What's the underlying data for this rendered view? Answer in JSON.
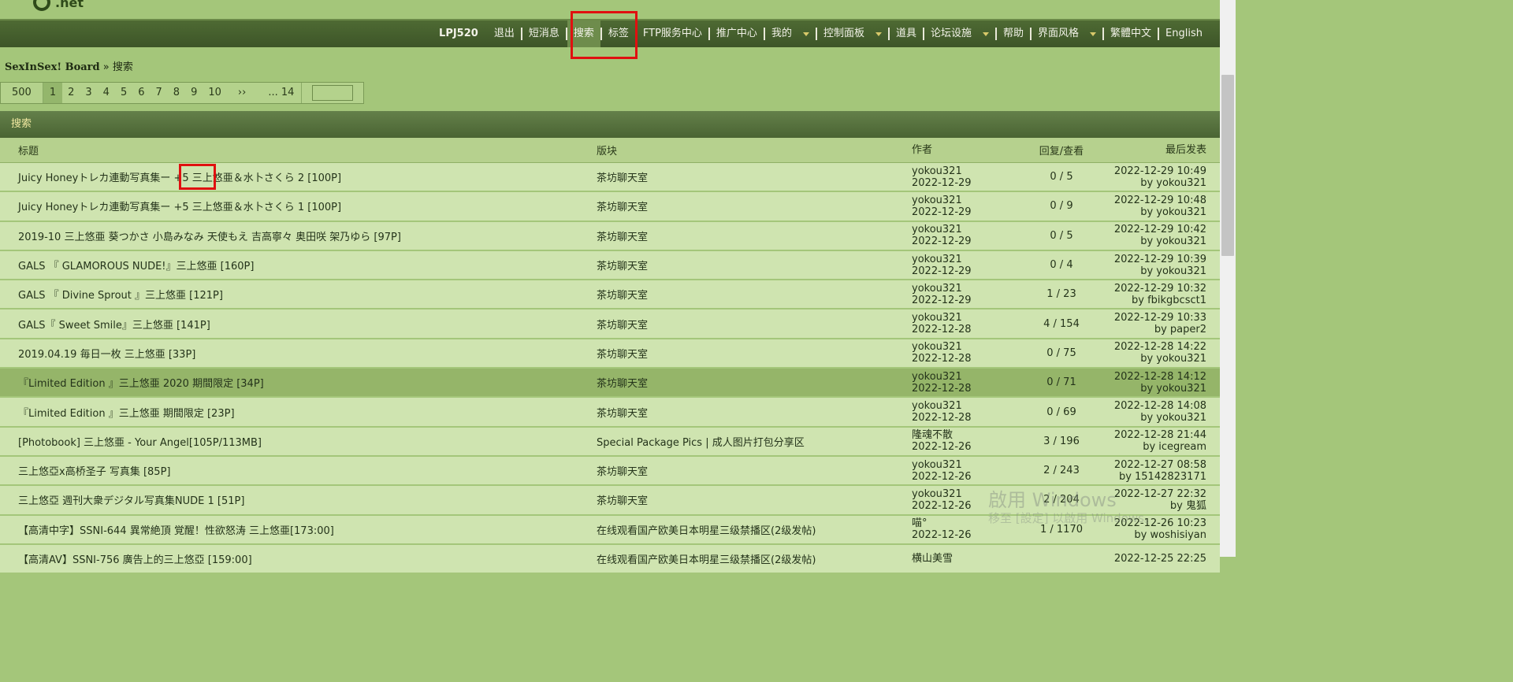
{
  "site": {
    "logo_text": ".net"
  },
  "nav": {
    "user": "LPJ520",
    "items": [
      {
        "label": "退出"
      },
      {
        "label": "短消息"
      },
      {
        "label": "搜索"
      },
      {
        "label": "标签"
      },
      {
        "label": "FTP服务中心"
      },
      {
        "label": "推广中心"
      },
      {
        "label": "我的"
      },
      {
        "label": "控制面板"
      },
      {
        "label": "道具"
      },
      {
        "label": "论坛设施"
      },
      {
        "label": "帮助"
      },
      {
        "label": "界面风格"
      },
      {
        "label": "繁體中文"
      },
      {
        "label": "English"
      }
    ]
  },
  "breadcrumb": {
    "board": "SexInSex! Board",
    "sep": " » ",
    "current": "搜索"
  },
  "pager": {
    "total": "500",
    "current": "1",
    "pages": [
      "2",
      "3",
      "4",
      "5",
      "6",
      "7",
      "8",
      "9",
      "10"
    ],
    "next": "››",
    "last": "... 14"
  },
  "section": {
    "title": "搜索"
  },
  "table": {
    "headers": {
      "title": "标题",
      "forum": "版块",
      "author": "作者",
      "replies": "回复/查看",
      "last": "最后发表"
    },
    "rows": [
      {
        "title": "Juicy Honeyトレカ連動写真集ー +5 三上悠亜＆水卜さくら 2 [100P]",
        "forum": "茶坊聊天室",
        "author": "yokou321",
        "date": "2022-12-29",
        "replies": "0 / 5",
        "last_time": "2022-12-29 10:49",
        "last_by": "by yokou321"
      },
      {
        "title": "Juicy Honeyトレカ連動写真集ー +5 三上悠亜＆水卜さくら 1 [100P]",
        "forum": "茶坊聊天室",
        "author": "yokou321",
        "date": "2022-12-29",
        "replies": "0 / 9",
        "last_time": "2022-12-29 10:48",
        "last_by": "by yokou321"
      },
      {
        "title": "2019-10 三上悠亜 葵つかさ 小島みなみ 天使もえ 吉高寧々 奥田咲 架乃ゆら [97P]",
        "forum": "茶坊聊天室",
        "author": "yokou321",
        "date": "2022-12-29",
        "replies": "0 / 5",
        "last_time": "2022-12-29 10:42",
        "last_by": "by yokou321"
      },
      {
        "title": "GALS 『 GLAMOROUS NUDE!』三上悠亜 [160P]",
        "forum": "茶坊聊天室",
        "author": "yokou321",
        "date": "2022-12-29",
        "replies": "0 / 4",
        "last_time": "2022-12-29 10:39",
        "last_by": "by yokou321"
      },
      {
        "title": "GALS 『 Divine Sprout 』三上悠亜 [121P]",
        "forum": "茶坊聊天室",
        "author": "yokou321",
        "date": "2022-12-29",
        "replies": "1 / 23",
        "last_time": "2022-12-29 10:32",
        "last_by": "by fbikgbcsct1"
      },
      {
        "title": "GALS『 Sweet Smile』三上悠亜 [141P]",
        "forum": "茶坊聊天室",
        "author": "yokou321",
        "date": "2022-12-28",
        "replies": "4 / 154",
        "last_time": "2022-12-29 10:33",
        "last_by": "by paper2"
      },
      {
        "title": "2019.04.19 毎日一枚 三上悠亜 [33P]",
        "forum": "茶坊聊天室",
        "author": "yokou321",
        "date": "2022-12-28",
        "replies": "0 / 75",
        "last_time": "2022-12-28 14:22",
        "last_by": "by yokou321"
      },
      {
        "title": "『Limited Edition 』三上悠亜 2020 期間限定 [34P]",
        "forum": "茶坊聊天室",
        "author": "yokou321",
        "date": "2022-12-28",
        "replies": "0 / 71",
        "last_time": "2022-12-28 14:12",
        "last_by": "by yokou321"
      },
      {
        "title": "『Limited Edition 』三上悠亜 期間限定 [23P]",
        "forum": "茶坊聊天室",
        "author": "yokou321",
        "date": "2022-12-28",
        "replies": "0 / 69",
        "last_time": "2022-12-28 14:08",
        "last_by": "by yokou321"
      },
      {
        "title": "[Photobook] 三上悠亜 - Your Angel[105P/113MB]",
        "forum": "Special Package Pics | 成人图片打包分享区",
        "author": "隆魂不散",
        "date": "2022-12-26",
        "replies": "3 / 196",
        "last_time": "2022-12-28 21:44",
        "last_by": "by icegream"
      },
      {
        "title": "三上悠亞x高桥圣子 写真集 [85P]",
        "forum": "茶坊聊天室",
        "author": "yokou321",
        "date": "2022-12-26",
        "replies": "2 / 243",
        "last_time": "2022-12-27 08:58",
        "last_by": "by 15142823171"
      },
      {
        "title": "三上悠亞 週刊大衆デジタル写真集NUDE 1 [51P]",
        "forum": "茶坊聊天室",
        "author": "yokou321",
        "date": "2022-12-26",
        "replies": "2 / 204",
        "last_time": "2022-12-27 22:32",
        "last_by": "by 鬼狐"
      },
      {
        "title": "【高清中字】SSNI-644 異常絶頂 覚醒！性欲怒涛 三上悠亜[173:00]",
        "forum": "在线观看国产欧美日本明星三级禁播区(2级发帖)",
        "author": "喵°",
        "date": "2022-12-26",
        "replies": "1 / 1170",
        "last_time": "2022-12-26 10:23",
        "last_by": "by woshisiyan"
      },
      {
        "title": "【高清AV】SSNI-756 廣告上的三上悠亞 [159:00]",
        "forum": "在线观看国产欧美日本明星三级禁播区(2级发帖)",
        "author": "横山美雪",
        "date": "",
        "replies": "",
        "last_time": "2022-12-25 22:25",
        "last_by": ""
      }
    ]
  },
  "watermark": {
    "line1": "啟用 Windows",
    "line2": "移至 [設定] 以啟用 Windows。"
  },
  "colors": {
    "highlight": "#e01010",
    "nav_bg": "#4e6a33",
    "page_bg": "#a4c67a",
    "row_bg": "#cfe4b0"
  }
}
